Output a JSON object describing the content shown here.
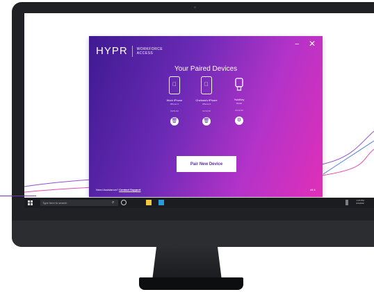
{
  "app": {
    "logo_mark": "HYPR",
    "logo_text_line1": "WORKFORCE",
    "logo_text_line2": "ACCESS",
    "minimize": "−",
    "close": "✕",
    "title": "Your Paired Devices",
    "devices": [
      {
        "name": "Work iPhone",
        "model": "iPhone X",
        "date": "04/01/22",
        "icon": "iphone-icon",
        "action_icon": "trash-icon"
      },
      {
        "name": "Chelsea's iPhone",
        "model": "iPhone 8",
        "date": "02/12/18",
        "icon": "iphone-icon",
        "action_icon": "trash-icon"
      },
      {
        "name": "YubiKey",
        "model": "Model",
        "date": "04/12/18",
        "icon": "security-key-icon",
        "action_icon": "settings-icon"
      }
    ],
    "pair_button": "Pair New Device",
    "footer_prompt": "Need Assistance?",
    "footer_link": "Contact Support",
    "version": "v5.4"
  },
  "taskbar": {
    "search_placeholder": "Type here to search",
    "clock_time": "1:15 PM",
    "clock_date": "4/1/2022"
  },
  "colors": {
    "gradient_start": "#3e1a92",
    "gradient_end": "#e02fb8",
    "monitor_frame": "#1f2125"
  }
}
